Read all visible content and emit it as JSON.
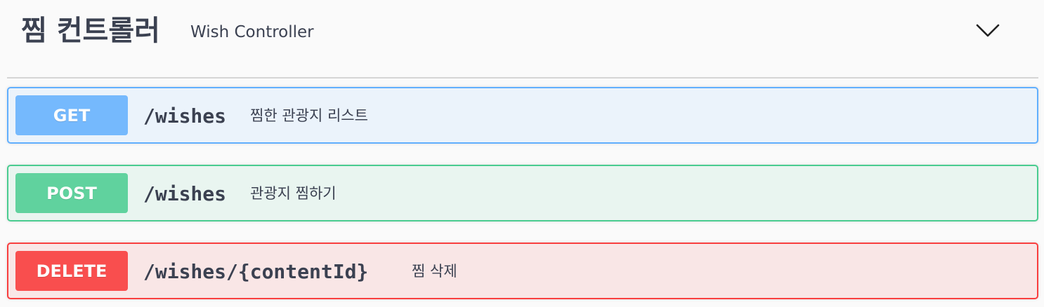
{
  "tag": {
    "title": "찜 컨트롤러",
    "description": "Wish Controller",
    "toggle_icon": "chevron-down-icon"
  },
  "operations": [
    {
      "method": "GET",
      "path": "/wishes",
      "summary": "찜한 관광지 리스트",
      "color": "#61affe",
      "background": "#ebf3fb"
    },
    {
      "method": "POST",
      "path": "/wishes",
      "summary": "관광지 찜하기",
      "color": "#49cc90",
      "background": "#e9f5f0"
    },
    {
      "method": "DELETE",
      "path": "/wishes/{contentId}",
      "summary": "찜 삭제",
      "color": "#f93e3e",
      "background": "#f9e6e6"
    }
  ]
}
